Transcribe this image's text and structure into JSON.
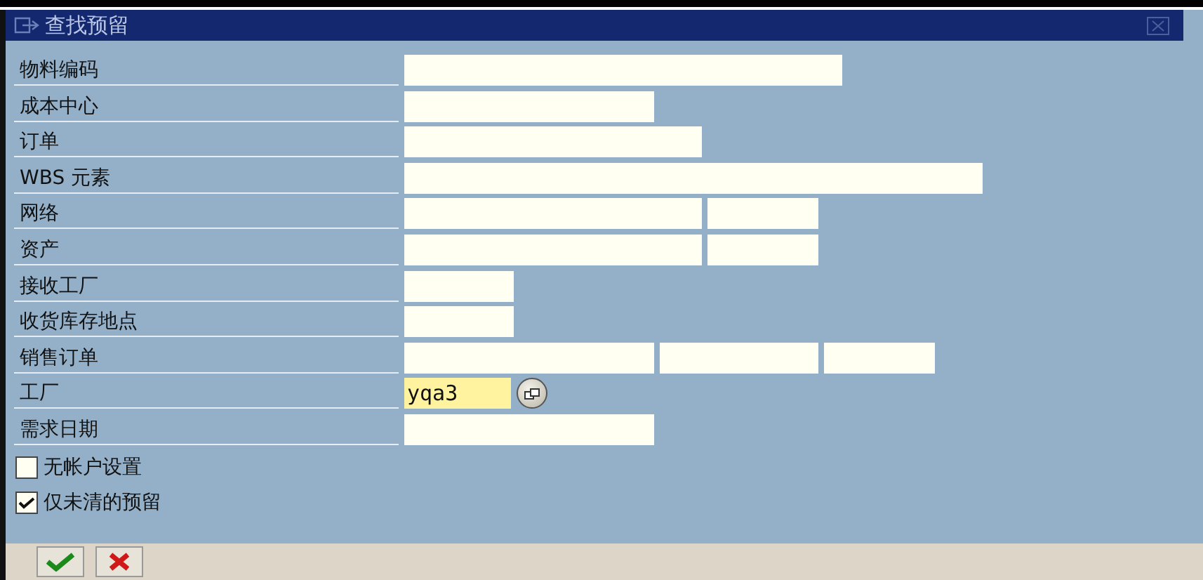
{
  "window": {
    "title": "查找预留"
  },
  "rows": [
    {
      "label": "物料编码",
      "kind": "text"
    },
    {
      "label": "成本中心",
      "kind": "text"
    },
    {
      "label": "订单",
      "kind": "text"
    },
    {
      "label": "WBS 元素",
      "kind": "text"
    },
    {
      "label": "网络",
      "kind": "text"
    },
    {
      "label": "资产",
      "kind": "text"
    },
    {
      "label": "接收工厂",
      "kind": "text"
    },
    {
      "label": "收货库存地点",
      "kind": "text"
    },
    {
      "label": "销售订单",
      "kind": "text"
    },
    {
      "label": "工厂",
      "kind": "lookup",
      "value": "yqa3",
      "focused": true
    },
    {
      "label": "需求日期",
      "kind": "text"
    }
  ],
  "checkboxes": [
    {
      "label": "无帐户设置",
      "checked": false
    },
    {
      "label": "仅未清的预留",
      "checked": true
    }
  ]
}
